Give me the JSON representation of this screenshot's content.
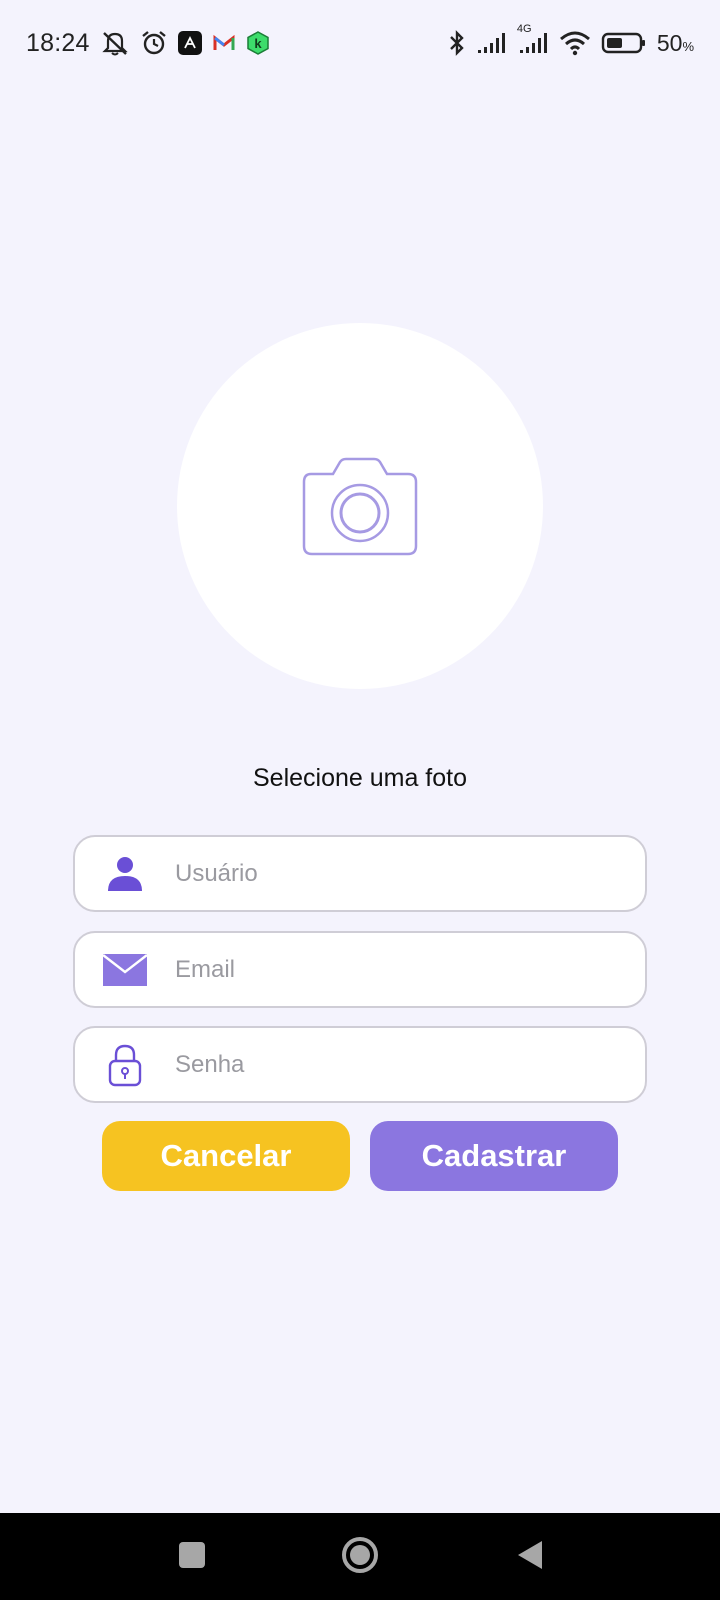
{
  "status_bar": {
    "time": "18:24",
    "network_label": "4G",
    "battery_percent": "50",
    "battery_unit": "%",
    "battery_level": 0.5,
    "icons": [
      "bell-off-icon",
      "alarm-icon",
      "app-notification-icon",
      "gmail-icon",
      "k-app-icon",
      "bluetooth-icon",
      "signal-icon",
      "signal-4g-icon",
      "wifi-icon",
      "battery-icon"
    ]
  },
  "photo_picker": {
    "icon": "camera-icon",
    "label": "Selecione uma foto"
  },
  "form": {
    "username": {
      "placeholder": "Usuário",
      "value": "",
      "icon": "user-icon"
    },
    "email": {
      "placeholder": "Email",
      "value": "",
      "icon": "mail-icon"
    },
    "password": {
      "placeholder": "Senha",
      "value": "",
      "icon": "lock-icon"
    }
  },
  "buttons": {
    "cancel_label": "Cancelar",
    "submit_label": "Cadastrar"
  },
  "colors": {
    "background": "#f4f3fd",
    "accent_purple": "#8b76e0",
    "accent_yellow": "#f6c321",
    "icon_purple": "#6a4fd6"
  },
  "nav_bar": {
    "icons": [
      "recent-apps-icon",
      "home-icon",
      "back-icon"
    ]
  }
}
